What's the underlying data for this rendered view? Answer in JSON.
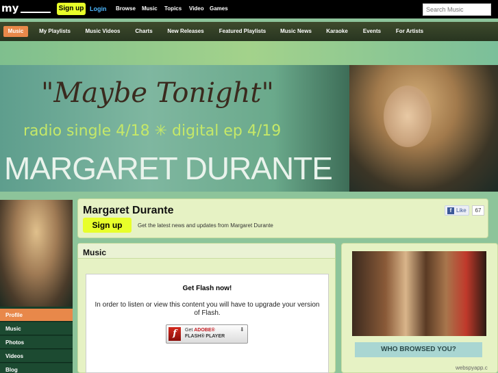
{
  "topbar": {
    "logo": "my",
    "signup": "Sign up",
    "login": "Login",
    "nav": [
      "Browse",
      "Music",
      "Topics",
      "Video",
      "Games"
    ],
    "search_placeholder": "Search Music"
  },
  "navbar": {
    "items": [
      "Music",
      "My Playlists",
      "Music Videos",
      "Charts",
      "New Releases",
      "Featured Playlists",
      "Music News",
      "Karaoke",
      "Events",
      "For Artists"
    ],
    "active": "Music"
  },
  "banner": {
    "title": "\"Maybe Tonight\"",
    "subtitle": "radio single 4/18  ✳  digital ep 4/19",
    "name": "MARGARET DURANTE"
  },
  "sidebar": {
    "items": [
      "Profile",
      "Music",
      "Photos",
      "Videos",
      "Blog"
    ],
    "active": "Profile"
  },
  "header": {
    "artist": "Margaret Durante",
    "signup": "Sign up",
    "tagline": "Get the latest news and updates from Margaret Durante",
    "like_label": "Like",
    "like_count": "67"
  },
  "music": {
    "heading": "Music",
    "flash_title": "Get Flash now!",
    "flash_text": "In order to listen or view this content you will have to upgrade your version of Flash.",
    "flash_btn_line1_a": "Get ",
    "flash_btn_line1_b": "ADOBE®",
    "flash_btn_line2": "FLASH® PLAYER"
  },
  "right": {
    "who_browsed": "WHO BROWSED YOU?"
  },
  "watermark": "webspyapp.c",
  "colors": {
    "accent": "#e8ff2a",
    "active_tab": "#e8884a",
    "card_bg": "#e6f2c4",
    "sidebar_bg": "#1c4a31"
  }
}
